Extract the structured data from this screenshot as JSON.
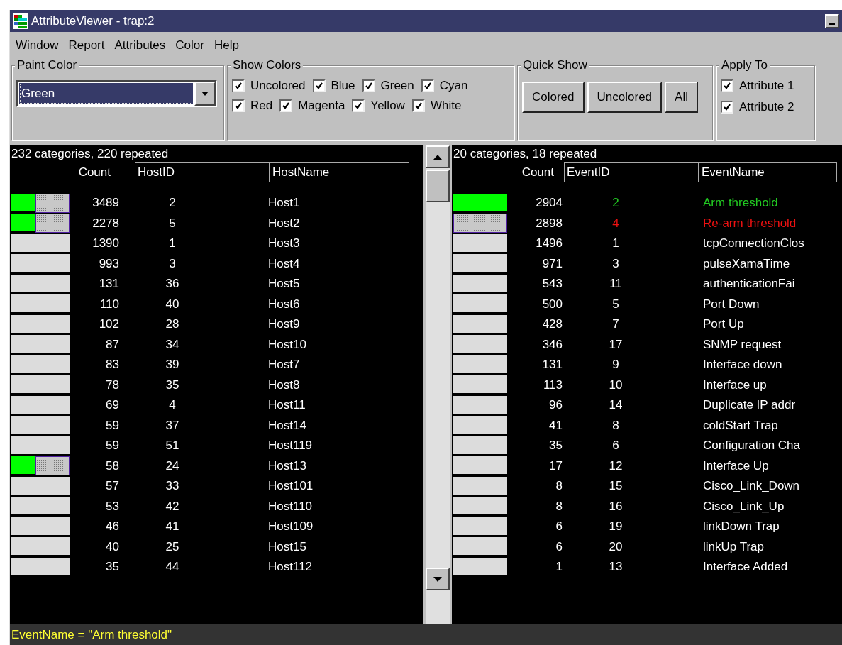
{
  "window": {
    "title": "AttributeViewer - trap:2"
  },
  "menu": [
    "Window",
    "Report",
    "Attributes",
    "Color",
    "Help"
  ],
  "paint_color": {
    "title": "Paint Color",
    "value": "Green"
  },
  "show_colors": {
    "title": "Show Colors",
    "options": [
      {
        "label": "Uncolored",
        "checked": true
      },
      {
        "label": "Blue",
        "checked": true
      },
      {
        "label": "Green",
        "checked": true
      },
      {
        "label": "Cyan",
        "checked": true
      },
      {
        "label": "Red",
        "checked": true
      },
      {
        "label": "Magenta",
        "checked": true
      },
      {
        "label": "Yellow",
        "checked": true
      },
      {
        "label": "White",
        "checked": true
      }
    ]
  },
  "quick_show": {
    "title": "Quick Show",
    "buttons": [
      "Colored",
      "Uncolored",
      "All"
    ]
  },
  "apply_to": {
    "title": "Apply To",
    "options": [
      {
        "label": "Attribute 1",
        "checked": true
      },
      {
        "label": "Attribute 2",
        "checked": true
      }
    ]
  },
  "panels": [
    {
      "summary": "232 categories, 220 repeated",
      "columns": [
        "Count",
        "HostID",
        "HostName"
      ],
      "rows": [
        {
          "count": "3489",
          "id": "2",
          "name": "Host1",
          "bar": {
            "color": "#00ff00",
            "selected": true
          }
        },
        {
          "count": "2278",
          "id": "5",
          "name": "Host2",
          "bar": {
            "color": "#00ff00",
            "selected": true
          }
        },
        {
          "count": "1390",
          "id": "1",
          "name": "Host3",
          "bar": {
            "color": "#dcdcdc",
            "selected": false
          }
        },
        {
          "count": "993",
          "id": "3",
          "name": "Host4",
          "bar": {
            "color": "#dcdcdc",
            "selected": false
          }
        },
        {
          "count": "131",
          "id": "36",
          "name": "Host5",
          "bar": {
            "color": "#dcdcdc",
            "selected": false
          }
        },
        {
          "count": "110",
          "id": "40",
          "name": "Host6",
          "bar": {
            "color": "#dcdcdc",
            "selected": false
          }
        },
        {
          "count": "102",
          "id": "28",
          "name": "Host9",
          "bar": {
            "color": "#dcdcdc",
            "selected": false
          }
        },
        {
          "count": "87",
          "id": "34",
          "name": "Host10",
          "bar": {
            "color": "#dcdcdc",
            "selected": false
          }
        },
        {
          "count": "83",
          "id": "39",
          "name": "Host7",
          "bar": {
            "color": "#dcdcdc",
            "selected": false
          }
        },
        {
          "count": "78",
          "id": "35",
          "name": "Host8",
          "bar": {
            "color": "#dcdcdc",
            "selected": false
          }
        },
        {
          "count": "69",
          "id": "4",
          "name": "Host11",
          "bar": {
            "color": "#dcdcdc",
            "selected": false
          }
        },
        {
          "count": "59",
          "id": "37",
          "name": "Host14",
          "bar": {
            "color": "#dcdcdc",
            "selected": false
          }
        },
        {
          "count": "59",
          "id": "51",
          "name": "Host119",
          "bar": {
            "color": "#dcdcdc",
            "selected": false
          }
        },
        {
          "count": "58",
          "id": "24",
          "name": "Host13",
          "bar": {
            "color": "#00ff00",
            "selected": true
          }
        },
        {
          "count": "57",
          "id": "33",
          "name": "Host101",
          "bar": {
            "color": "#dcdcdc",
            "selected": false
          }
        },
        {
          "count": "53",
          "id": "42",
          "name": "Host110",
          "bar": {
            "color": "#dcdcdc",
            "selected": false
          }
        },
        {
          "count": "46",
          "id": "41",
          "name": "Host109",
          "bar": {
            "color": "#dcdcdc",
            "selected": false
          }
        },
        {
          "count": "40",
          "id": "25",
          "name": "Host15",
          "bar": {
            "color": "#dcdcdc",
            "selected": false
          }
        },
        {
          "count": "35",
          "id": "44",
          "name": "Host112",
          "bar": {
            "color": "#dcdcdc",
            "selected": false
          }
        }
      ]
    },
    {
      "summary": "20 categories, 18 repeated",
      "columns": [
        "Count",
        "EventID",
        "EventName"
      ],
      "rows": [
        {
          "count": "2904",
          "id": "2",
          "name": "Arm threshold",
          "color": "#22cc22",
          "bar": {
            "color": "#00ff00",
            "selected": false
          }
        },
        {
          "count": "2898",
          "id": "4",
          "name": "Re-arm threshold",
          "color": "#ee1111",
          "bar": {
            "color": "#c8c8c8",
            "selected": true
          }
        },
        {
          "count": "1496",
          "id": "1",
          "name": "tcpConnectionClos",
          "bar": {
            "color": "#dcdcdc",
            "selected": false
          }
        },
        {
          "count": "971",
          "id": "3",
          "name": "pulseXamaTime",
          "bar": {
            "color": "#dcdcdc",
            "selected": false
          }
        },
        {
          "count": "543",
          "id": "11",
          "name": "authenticationFai",
          "bar": {
            "color": "#dcdcdc",
            "selected": false
          }
        },
        {
          "count": "500",
          "id": "5",
          "name": "Port Down",
          "bar": {
            "color": "#dcdcdc",
            "selected": false
          }
        },
        {
          "count": "428",
          "id": "7",
          "name": "Port Up",
          "bar": {
            "color": "#dcdcdc",
            "selected": false
          }
        },
        {
          "count": "346",
          "id": "17",
          "name": "SNMP request",
          "bar": {
            "color": "#dcdcdc",
            "selected": false
          }
        },
        {
          "count": "131",
          "id": "9",
          "name": "Interface down",
          "bar": {
            "color": "#dcdcdc",
            "selected": false
          }
        },
        {
          "count": "113",
          "id": "10",
          "name": "Interface up",
          "bar": {
            "color": "#dcdcdc",
            "selected": false
          }
        },
        {
          "count": "96",
          "id": "14",
          "name": "Duplicate IP addr",
          "bar": {
            "color": "#dcdcdc",
            "selected": false
          }
        },
        {
          "count": "41",
          "id": "8",
          "name": "coldStart Trap",
          "bar": {
            "color": "#dcdcdc",
            "selected": false
          }
        },
        {
          "count": "35",
          "id": "6",
          "name": "Configuration Cha",
          "bar": {
            "color": "#dcdcdc",
            "selected": false
          }
        },
        {
          "count": "17",
          "id": "12",
          "name": "Interface Up",
          "bar": {
            "color": "#dcdcdc",
            "selected": false
          }
        },
        {
          "count": "8",
          "id": "15",
          "name": "Cisco_Link_Down",
          "bar": {
            "color": "#dcdcdc",
            "selected": false
          }
        },
        {
          "count": "8",
          "id": "16",
          "name": "Cisco_Link_Up",
          "bar": {
            "color": "#dcdcdc",
            "selected": false
          }
        },
        {
          "count": "6",
          "id": "19",
          "name": "linkDown Trap",
          "bar": {
            "color": "#dcdcdc",
            "selected": false
          }
        },
        {
          "count": "6",
          "id": "20",
          "name": "linkUp Trap",
          "bar": {
            "color": "#dcdcdc",
            "selected": false
          }
        },
        {
          "count": "1",
          "id": "13",
          "name": "Interface Added",
          "bar": {
            "color": "#dcdcdc",
            "selected": false
          }
        }
      ]
    }
  ],
  "status_bar": "EventName = \"Arm threshold\""
}
